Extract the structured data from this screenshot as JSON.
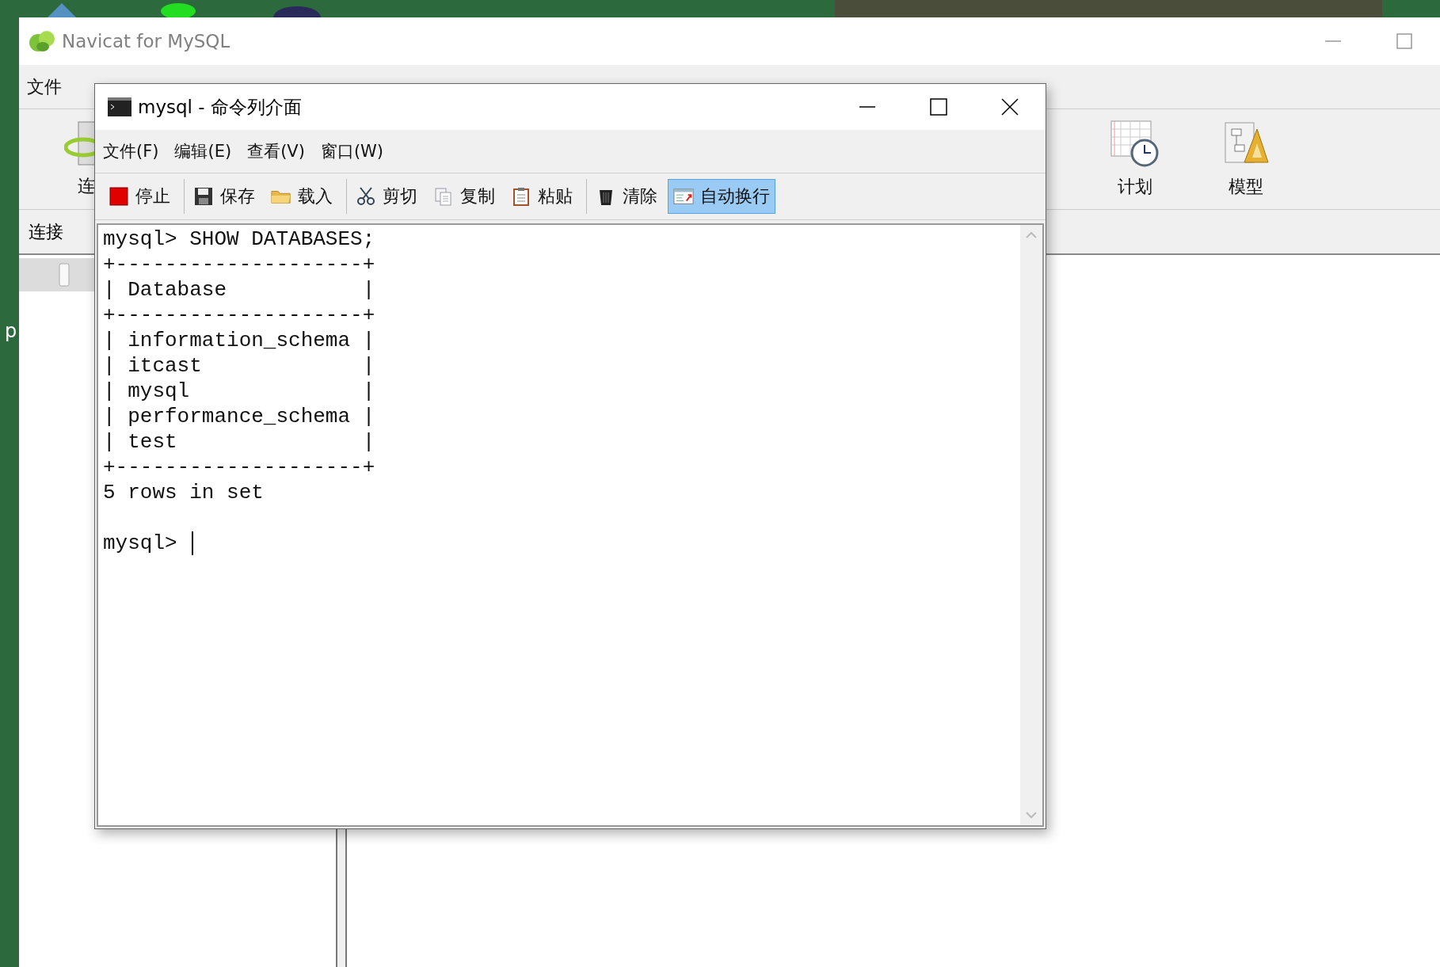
{
  "desktop": {
    "label": "p"
  },
  "main_window": {
    "title": "Navicat for MySQL",
    "menu": [
      "文件"
    ],
    "toolbar": {
      "left": [
        {
          "label": "连"
        }
      ],
      "right": [
        {
          "label": "计划"
        },
        {
          "label": "模型"
        }
      ]
    },
    "tab": {
      "label": "连接"
    },
    "connections": [
      {
        "selected": true
      }
    ]
  },
  "console_window": {
    "title": "mysql - 命令列介面",
    "menu": [
      "文件(F)",
      "编辑(E)",
      "查看(V)",
      "窗口(W)"
    ],
    "toolbar_groups": [
      [
        {
          "label": "停止",
          "selected": false
        }
      ],
      [
        {
          "label": "保存",
          "selected": false
        },
        {
          "label": "载入",
          "selected": false
        }
      ],
      [
        {
          "label": "剪切",
          "selected": false
        },
        {
          "label": "复制",
          "selected": false
        },
        {
          "label": "粘贴",
          "selected": false
        }
      ],
      [
        {
          "label": "清除",
          "selected": false
        },
        {
          "label": "自动换行",
          "selected": true
        }
      ]
    ],
    "output": [
      "mysql> SHOW DATABASES;",
      "+--------------------+",
      "| Database           |",
      "+--------------------+",
      "| information_schema |",
      "| itcast             |",
      "| mysql              |",
      "| performance_schema |",
      "| test               |",
      "+--------------------+",
      "5 rows in set"
    ],
    "prompt": {
      "text": "mysql>",
      "cursor": true
    }
  }
}
